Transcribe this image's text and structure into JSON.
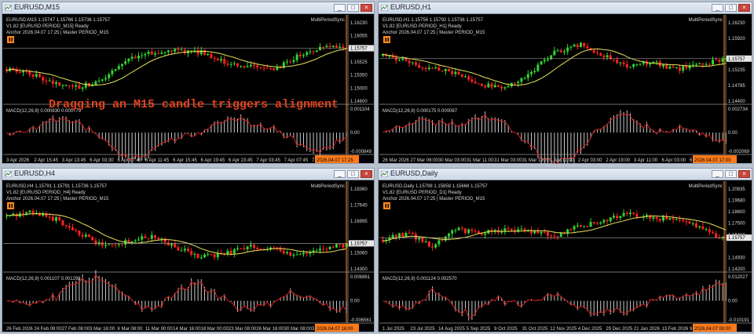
{
  "windows": [
    {
      "id": "m15",
      "title": "EURUSD,M15",
      "info_line1": "EURUSD,M15  1.15747 1.15766 1.15736 1.15757",
      "info_line2": "V1.82 [EURUSD PERIOD_M15] Ready",
      "info_line3": "Anchor 2026.04.07 17:25 | Master PERIOD_M15",
      "indicator_name": "MultiPeriodSync",
      "price_labels": [
        "1.16230",
        "1.16055",
        "1.15757",
        "1.15525",
        "1.15350",
        "1.15000",
        "1.14600"
      ],
      "current_price": "1.15757",
      "macd_label": "MACD(12,26,9) 0.000830 0.000779",
      "macd_scale": [
        "0.001104",
        "0.00",
        "-0.000849"
      ],
      "time_labels": [
        "3 Apr 2026",
        "2 Apr 15:45",
        "3 Apr 13:45",
        "6 Apr 03:30",
        "6 Apr 07:45",
        "6 Apr 11:45",
        "6 Apr 15:45",
        "6 Apr 19:45",
        "6 Apr 23:45",
        "7 Apr 03:45",
        "7 Apr 07:45",
        "7 Apr 11:45"
      ],
      "time_highlight": "2026.04.07 17:25",
      "drag_message": "Dragging an M15 candle triggers alignment"
    },
    {
      "id": "h1",
      "title": "EURUSD,H1",
      "info_line1": "EURUSD,H1  1.15756 1.15792 1.15736 1.15757",
      "info_line2": "V1.82 [EURUSD PERIOD_H1] Ready",
      "info_line3": "Anchor 2026.04.07 17:25 | Master PERIOD_M15",
      "indicator_name": "MultiPeriodSync",
      "price_labels": [
        "1.16230",
        "1.15920",
        "1.15757",
        "1.15235",
        "1.14785",
        "1.14400"
      ],
      "current_price": "1.15757",
      "macd_label": "MACD(12,26,9) 0.000175 0.000087",
      "macd_scale": [
        "0.002734",
        "0.00",
        "-0.002069"
      ],
      "time_labels": [
        "26 Mar 2026",
        "27 Mar 06:00",
        "30 Mar 03:00",
        "31 Mar 11:00",
        "31 Mar 03:00",
        "31 Mar 19:00",
        "1 Apr 11:00",
        "2 Apr 03:00",
        "2 Apr 19:00",
        "3 Apr 11:00",
        "6 Apr 03:00",
        "6 Apr 19:00"
      ],
      "time_highlight": "2026.04.07 17:00"
    },
    {
      "id": "h4",
      "title": "EURUSD,H4",
      "info_line1": "EURUSD,H4  1.15791 1.15791 1.15736 1.15757",
      "info_line2": "V1.82 [EURUSD PERIOD_H4] Ready",
      "info_line3": "Anchor 2026.04.07 17:25 | Master PERIOD_M15",
      "indicator_name": "MultiPeriodSync",
      "price_labels": [
        "1.18360",
        "1.17640",
        "1.16995",
        "1.15757",
        "1.15060",
        "1.14300"
      ],
      "current_price": "1.15757",
      "macd_label": "MACD(12,26,9) 0.001107 0.001298",
      "macd_scale": [
        "0.006861",
        "0.00",
        "-0.006561"
      ],
      "time_labels": [
        "26 Feb 2026",
        "24 Feb 08:00",
        "27 Feb 08:00",
        "3 Mar 16:00",
        "6 Mar 08:00",
        "11 Mar 00:00",
        "14 Mar 16:00",
        "18 Mar 00:00",
        "23 Mar 08:00",
        "26 Mar 16:00",
        "30 Mar 08:00",
        "3 Apr 00:00"
      ],
      "time_highlight": "2026.04.07 16:00"
    },
    {
      "id": "d1",
      "title": "EURUSD,Daily",
      "info_line1": "EURUSD,Daily  1.15798 1.15858 1.15666 1.15757",
      "info_line2": "V1.82 [EURUSD PERIOD_D1] Ready",
      "info_line3": "Anchor 2026.04.07 17:25 | Master PERIOD_M15",
      "indicator_name": "MultiPeriodSync",
      "price_labels": [
        "1.20835",
        "1.19680",
        "1.18600",
        "1.17500",
        "1.16410",
        "1.15757",
        "1.14930",
        "1.14200"
      ],
      "current_price": "1.15757",
      "macd_label": "MACD(12,26,9) 0.001124 0.002570",
      "macd_scale": [
        "0.012027",
        "0.00",
        "-0.010191"
      ],
      "time_labels": [
        "1 Jul 2025",
        "23 Jul 2025",
        "14 Aug 2025",
        "5 Sep 2025",
        "9 Oct 2025",
        "31 Oct 2025",
        "12 Nov 2025",
        "4 Dec 2025",
        "29 Dec 2025",
        "21 Jan 2026",
        "13 Feb 2026",
        "9 Mar 2026"
      ],
      "time_highlight": "2026.04.07 00:00"
    }
  ],
  "colors": {
    "background": "#000000",
    "bull_candle": "#2fd42f",
    "bear_candle": "#ff2020",
    "moving_average": "#e8e35a",
    "macd_histogram": "#c8c8c8",
    "macd_signal": "#d21e1e",
    "price_line": "#b0b0b0",
    "anchor_line": "#ff8a1e",
    "axis_text": "#d8d8d8",
    "highlight_label": "#ff7a1a",
    "drag_text": "#e0421f"
  },
  "icons": {
    "window_icon": "chart-window-icon",
    "indicator_badge": "ea-badge-icon"
  },
  "window_buttons": {
    "minimize": "_",
    "maximize": "□",
    "close": "×"
  }
}
